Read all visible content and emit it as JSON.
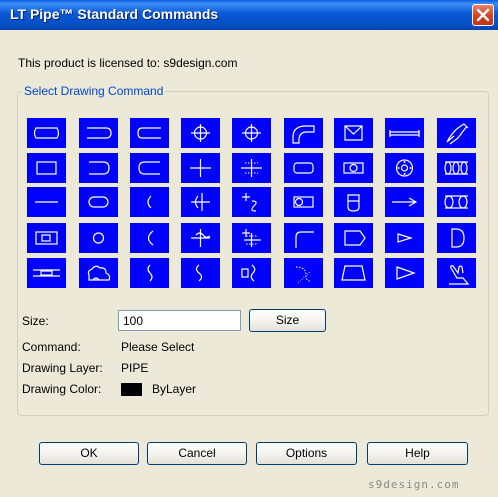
{
  "window": {
    "title": "LT Pipe™ Standard Commands"
  },
  "license_text": "This product is licensed to: s9design.com",
  "group_label": "Select Drawing Command",
  "command_icons": [
    "curved-pipe-end-icon",
    "pipe-cap-icon",
    "open-pipe-end-icon",
    "crosshair-circle-icon",
    "crosshair-circle-icon",
    "elbow-90-icon",
    "valve-box-icon",
    "pipe-run-icon",
    "elbow-segmented-icon",
    "rectangle-icon",
    "half-round-end-icon",
    "open-end-icon",
    "cross-icon",
    "cross-dotted-icon",
    "rounded-rect-icon",
    "rect-with-box-icon",
    "flange-circle-icon",
    "multi-ring-icon",
    "horizontal-line-icon",
    "slot-icon",
    "arc-small-icon",
    "cross-arc-icon",
    "cross-s-curve-icon",
    "pipe-with-ring-icon",
    "half-circle-box-icon",
    "arrow-right-icon",
    "double-ring-icon",
    "box-in-box-icon",
    "circle-icon",
    "arc-large-icon",
    "cross-wave-icon",
    "cross-bend-icon",
    "fillet-corner-icon",
    "pentagon-icon",
    "small-arrow-icon",
    "d-shape-icon",
    "dashed-box-icon",
    "cloud-icon",
    "wave-vertical-icon",
    "s-curve-icon",
    "squiggle-box-icon",
    "dotted-bend-icon",
    "trapezoid-icon",
    "pointer-arrow-icon",
    "hand-icon"
  ],
  "size": {
    "label": "Size:",
    "value": "100",
    "button": "Size"
  },
  "command": {
    "label": "Command:",
    "value": "Please Select"
  },
  "layer": {
    "label": "Drawing Layer:",
    "value": "PIPE"
  },
  "color": {
    "label": "Drawing Color:",
    "value": "ByLayer",
    "swatch": "#000000"
  },
  "buttons": {
    "ok": "OK",
    "cancel": "Cancel",
    "options": "Options",
    "help": "Help"
  },
  "watermark": "s9design.com",
  "theme": {
    "button_blue": "#0000ff",
    "title_blue": "#0a58d6",
    "close_red": "#d4401e"
  }
}
